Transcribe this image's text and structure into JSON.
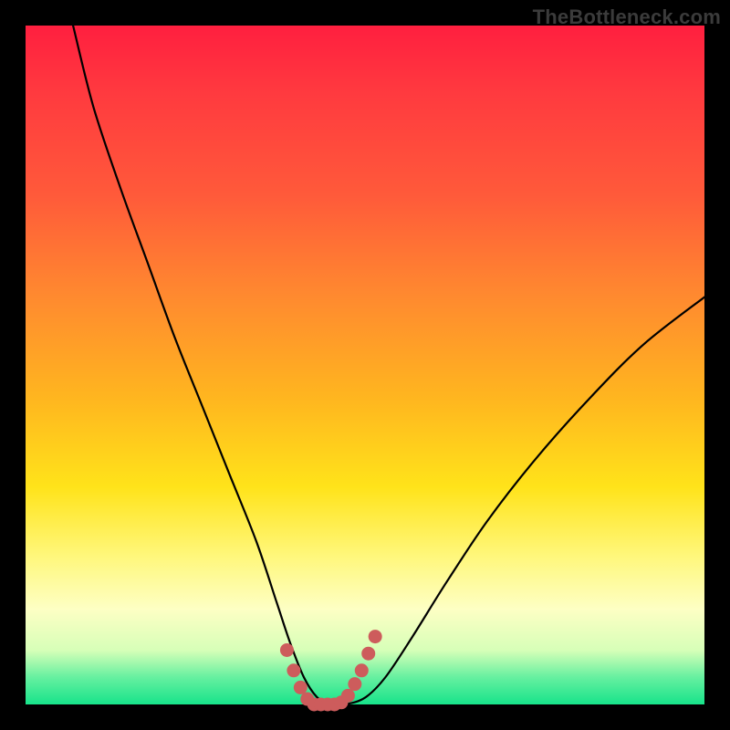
{
  "watermark": {
    "text": "TheBottleneck.com"
  },
  "chart_data": {
    "type": "line",
    "title": "",
    "xlabel": "",
    "ylabel": "",
    "xlim": [
      0,
      100
    ],
    "ylim": [
      0,
      100
    ],
    "series": [
      {
        "name": "curve",
        "x": [
          7,
          10,
          14,
          18,
          22,
          26,
          30,
          34,
          37,
          39,
          41,
          43,
          45,
          47,
          50,
          53,
          57,
          62,
          68,
          75,
          83,
          91,
          100
        ],
        "y": [
          100,
          88,
          76,
          65,
          54,
          44,
          34,
          24,
          15,
          9,
          4,
          1,
          0,
          0,
          1,
          4,
          10,
          18,
          27,
          36,
          45,
          53,
          60
        ]
      }
    ],
    "highlight": {
      "name": "valley-marker",
      "color": "#cd5c5c",
      "x": [
        38.5,
        39.5,
        40.5,
        41.5,
        42.5,
        43.5,
        44.5,
        45.5,
        46.5,
        47.5,
        48.5,
        49.5,
        50.5,
        51.5
      ],
      "y": [
        8,
        5,
        2.5,
        0.8,
        0,
        0,
        0,
        0,
        0.3,
        1.3,
        3,
        5,
        7.5,
        10
      ]
    }
  }
}
